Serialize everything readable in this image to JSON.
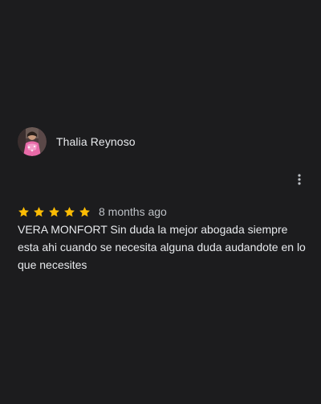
{
  "review": {
    "reviewer_name": "Thalia Reynoso",
    "avatar": "reviewer-avatar-photo",
    "rating": 5,
    "max_rating": 5,
    "time_ago": "8 months ago",
    "text": "VERA MONFORT Sin duda la mejor abogada siempre esta ahi cuando se necesita alguna duda audandote en lo que necesites",
    "more_icon": "more-vert-icon"
  },
  "colors": {
    "background": "#1c1c1e",
    "text": "#e8eaed",
    "secondary_text": "#bdc1c6",
    "star": "#fbbc04"
  }
}
